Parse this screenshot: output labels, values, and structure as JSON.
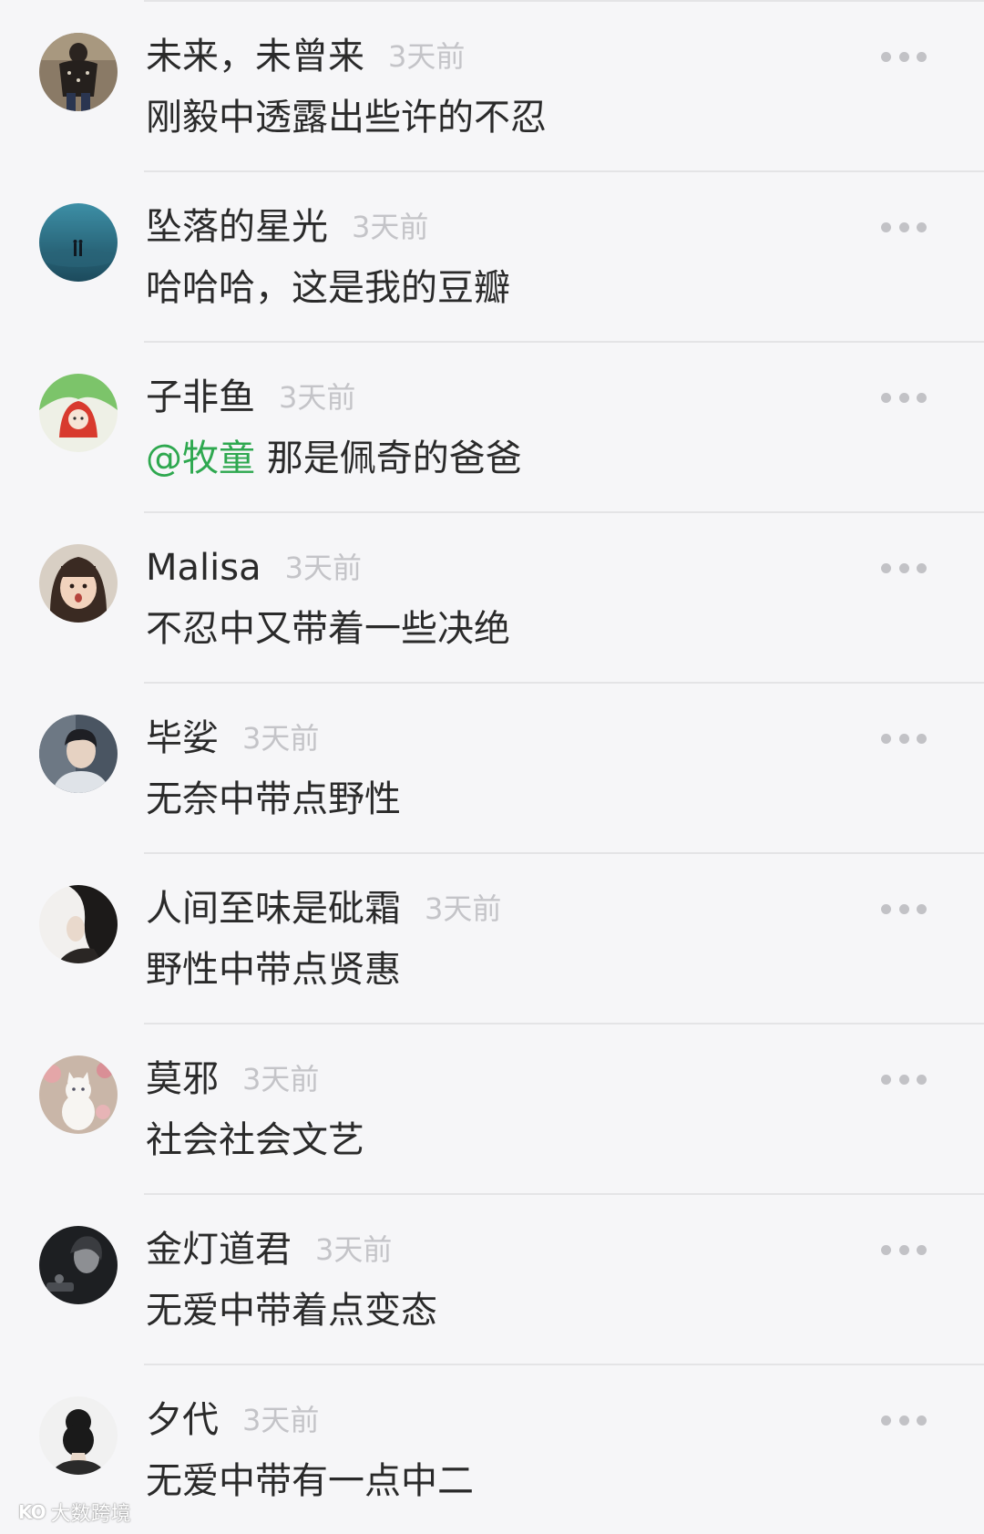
{
  "comments": [
    {
      "name": "未来，未曾来",
      "time": "3天前",
      "content": "刚毅中透露出些许的不忍",
      "avatar": "avatar-person-standing"
    },
    {
      "name": "坠落的星光",
      "time": "3天前",
      "content": "哈哈哈，这是我的豆瓣",
      "avatar": "avatar-couple-at-sea"
    },
    {
      "name": "子非鱼",
      "time": "3天前",
      "mention": "@牧童",
      "content": " 那是佩奇的爸爸",
      "avatar": "avatar-red-hood-drawing"
    },
    {
      "name": "Malisa",
      "time": "3天前",
      "content": "不忍中又带着一些决绝",
      "avatar": "avatar-child-face"
    },
    {
      "name": "毕娑",
      "time": "3天前",
      "content": "无奈中带点野性",
      "avatar": "avatar-man-portrait"
    },
    {
      "name": "人间至味是砒霜",
      "time": "3天前",
      "content": "野性中带点贤惠",
      "avatar": "avatar-woman-hair"
    },
    {
      "name": "莫邪",
      "time": "3天前",
      "content": "社会社会文艺",
      "avatar": "avatar-white-cat"
    },
    {
      "name": "金灯道君",
      "time": "3天前",
      "content": "无爱中带着点变态",
      "avatar": "avatar-dark-portrait"
    },
    {
      "name": "夕代",
      "time": "3天前",
      "content": "无爱中带有一点中二",
      "avatar": "avatar-bun-hair"
    }
  ],
  "watermark": {
    "mark": "KO",
    "text": "大数跨境"
  },
  "colors": {
    "mention": "#2ea84f",
    "time": "#c4c4c8",
    "text": "#2a2a2a",
    "background": "#f6f6f8"
  }
}
